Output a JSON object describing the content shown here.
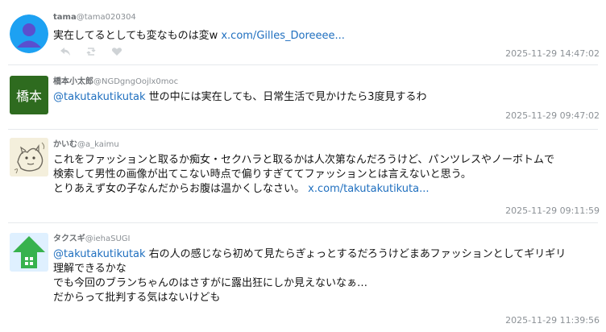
{
  "tweets": [
    {
      "name": "tama",
      "handle": "@tama020304",
      "lines": [
        "実在してるとしても変なものは変w "
      ],
      "link": "x.com/Gilles_Doreeee...",
      "timestamp": "2025-11-29 14:47:02",
      "avatar": "person-placeholder"
    },
    {
      "name": "橋本小太郎",
      "handle": "@NGDgngOojlx0moc",
      "avatar_text": "橋本",
      "mention": "@takutakutikutak",
      "lines": [
        " 世の中には実在しても、日常生活で見かけたら3度見するわ"
      ],
      "timestamp": "2025-11-29 09:47:02"
    },
    {
      "name": "かいむ",
      "handle": "@a_kaimu",
      "lines": [
        "これをファッションと取るか痴女・セクハラと取るかは人次第なんだろうけど、パンツレスやノーボトムで",
        "検索して男性の画像が出てこない時点で偏りすぎててファッションとは言えないと思う。",
        "とりあえず女の子なんだからお腹は温かくしなさい。 "
      ],
      "link": "x.com/takutakutikuta...",
      "timestamp": "2025-11-29 09:11:59",
      "avatar": "cat-sketch"
    },
    {
      "name": "タクスギ",
      "handle": "@iehaSUGI",
      "mention": "@takutakutikutak",
      "lines": [
        " 右の人の感じなら初めて見たらぎょっとするだろうけどまあファッションとしてギリギリ",
        "理解できるかな",
        "でも今回のブランちゃんのはさすがに露出狂にしか見えないなぁ…",
        "だからって批判する気はないけども"
      ],
      "timestamp": "2025-11-29 11:39:56",
      "avatar": "house-arrow"
    }
  ],
  "colors": {
    "link": "#1f6fbf",
    "avatar1_bg": "#1da1f2",
    "avatar2_bg": "#2e6b1f",
    "avatar4_bg": "#37b24d"
  },
  "icons": [
    "reply-icon",
    "retweet-icon",
    "like-icon"
  ]
}
